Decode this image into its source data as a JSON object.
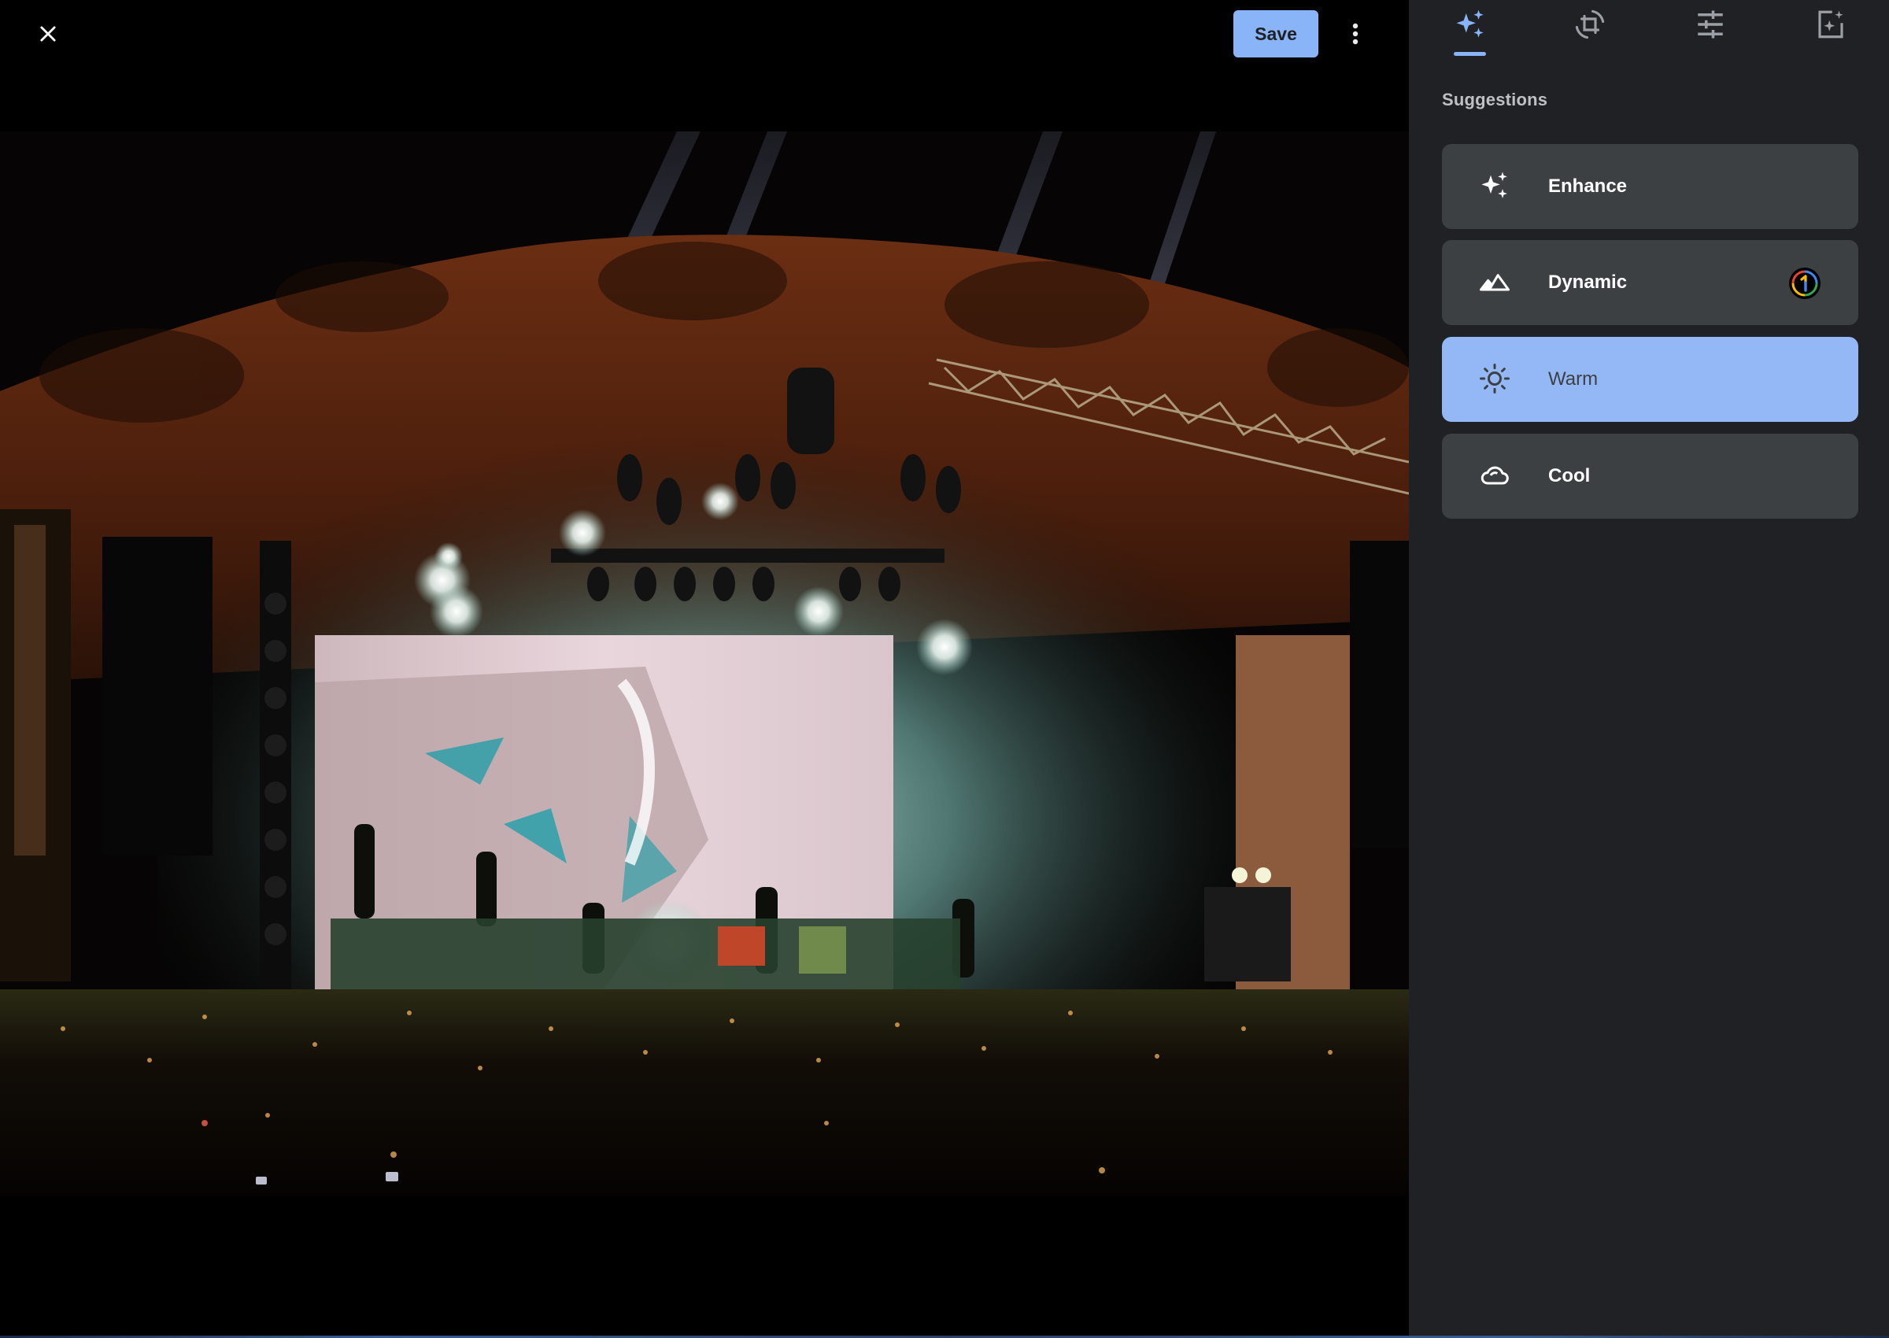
{
  "viewer": {
    "close_icon": "close-icon",
    "save_label": "Save",
    "more_icon": "more-vert-icon",
    "photo_description": "Night concert stage with light rigs, LED video wall and crowd"
  },
  "panel": {
    "tabs": [
      {
        "id": "suggestions",
        "icon": "auto-awesome-icon",
        "active": true
      },
      {
        "id": "crop",
        "icon": "crop-rotate-icon",
        "active": false
      },
      {
        "id": "adjust",
        "icon": "tune-icon",
        "active": false
      },
      {
        "id": "filters",
        "icon": "filters-icon",
        "active": false
      }
    ],
    "section_title": "Suggestions",
    "suggestions": [
      {
        "label": "Enhance",
        "icon": "auto-awesome-icon",
        "selected": false,
        "badge": null
      },
      {
        "label": "Dynamic",
        "icon": "landscape-icon",
        "selected": false,
        "badge": "google-one-icon"
      },
      {
        "label": "Warm",
        "icon": "sun-icon",
        "selected": true,
        "badge": null
      },
      {
        "label": "Cool",
        "icon": "cloud-icon",
        "selected": false,
        "badge": null
      }
    ]
  },
  "colors": {
    "accent": "#8ab4f8",
    "selected_card": "#93b8f5",
    "card": "#3c4043",
    "panel_bg": "#202124",
    "viewer_bg": "#000000"
  }
}
